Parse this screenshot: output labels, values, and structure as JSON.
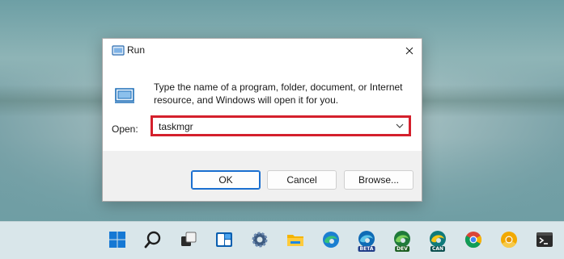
{
  "dialog": {
    "title": "Run",
    "description": "Type the name of a program, folder, document, or Internet resource, and Windows will open it for you.",
    "open_label": "Open:",
    "open_value": "taskmgr",
    "ok_label": "OK",
    "cancel_label": "Cancel",
    "browse_label": "Browse..."
  },
  "taskbar": {
    "items": [
      {
        "name": "start-icon"
      },
      {
        "name": "search-icon"
      },
      {
        "name": "task-view-icon"
      },
      {
        "name": "widgets-icon"
      },
      {
        "name": "settings-icon"
      },
      {
        "name": "file-explorer-icon"
      },
      {
        "name": "edge-icon"
      },
      {
        "name": "edge-beta-icon",
        "badge": "BETA"
      },
      {
        "name": "edge-dev-icon",
        "badge": "DEV"
      },
      {
        "name": "edge-canary-icon",
        "badge": "CAN"
      },
      {
        "name": "chrome-icon"
      },
      {
        "name": "chrome-canary-icon"
      },
      {
        "name": "terminal-icon"
      }
    ]
  },
  "colors": {
    "highlight": "#d4202c",
    "accent": "#1a6fd0"
  }
}
